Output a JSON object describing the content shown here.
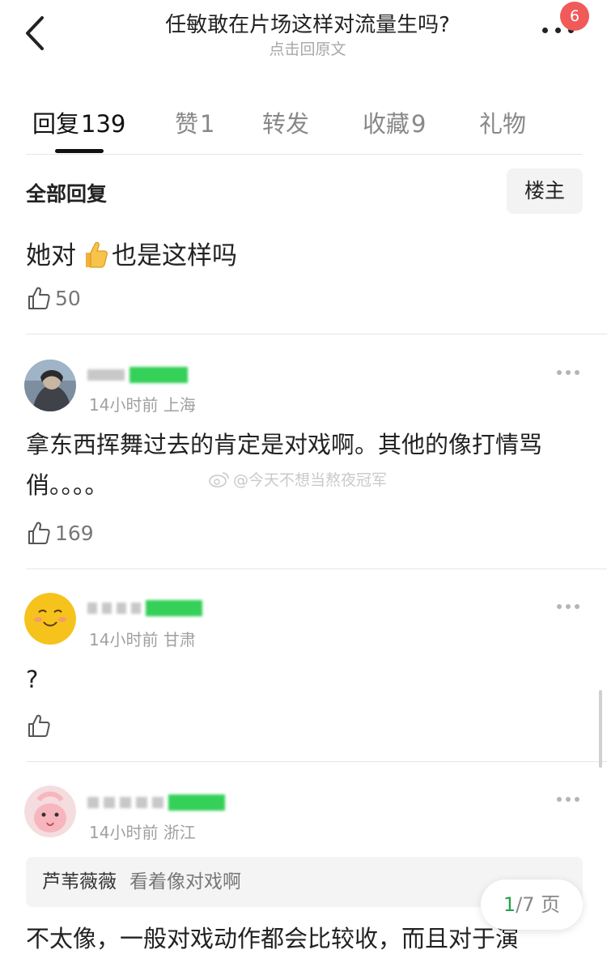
{
  "header": {
    "title": "任敏敢在片场这样对流量生吗?",
    "subtitle": "点击回原文",
    "notification_count": "6"
  },
  "tabs": [
    {
      "label": "回复",
      "count": "139",
      "active": true
    },
    {
      "label": "赞",
      "count": "1",
      "active": false
    },
    {
      "label": "转发",
      "count": "",
      "active": false
    },
    {
      "label": "收藏",
      "count": "9",
      "active": false
    },
    {
      "label": "礼物",
      "count": "",
      "active": false
    }
  ],
  "filter": {
    "section_title": "全部回复",
    "op_button": "楼主"
  },
  "op_post": {
    "text_before": "她对",
    "text_after": "也是这样吗",
    "likes": "50"
  },
  "comments": [
    {
      "time": "14小时前",
      "location": "上海",
      "text": "拿东西挥舞过去的肯定是对戏啊。其他的像打情骂俏。。。。",
      "likes": "169"
    },
    {
      "time": "14小时前",
      "location": "甘肃",
      "text": "?",
      "likes": ""
    },
    {
      "time": "14小时前",
      "location": "浙江",
      "quote": {
        "author": "芦苇薇薇",
        "text": "看着像对戏啊"
      },
      "text": "不太像，一般对戏动作都会比较收，而且对于演"
    }
  ],
  "watermark": "@今天不想当熬夜冠军",
  "pagination": {
    "current": "1",
    "total": "/7",
    "unit": "页"
  },
  "colors": {
    "accent_green": "#2aa14a",
    "badge_red": "#f05a58"
  }
}
